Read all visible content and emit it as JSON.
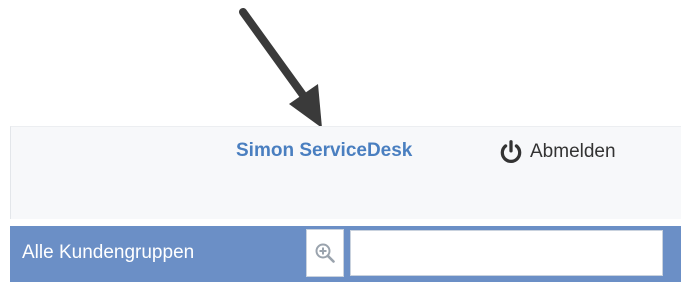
{
  "header": {
    "user_name": "Simon ServiceDesk",
    "logout_label": "Abmelden",
    "logout_icon": "power-icon"
  },
  "filter_bar": {
    "label": "Alle Kundengruppen",
    "search_icon": "zoom-in-icon",
    "search_value": ""
  },
  "annotation": {
    "icon": "arrow-down-icon",
    "color": "#3a3a3a"
  },
  "colors": {
    "accent": "#4a7fc0",
    "filter_bar_bg": "#6b8fc6"
  }
}
